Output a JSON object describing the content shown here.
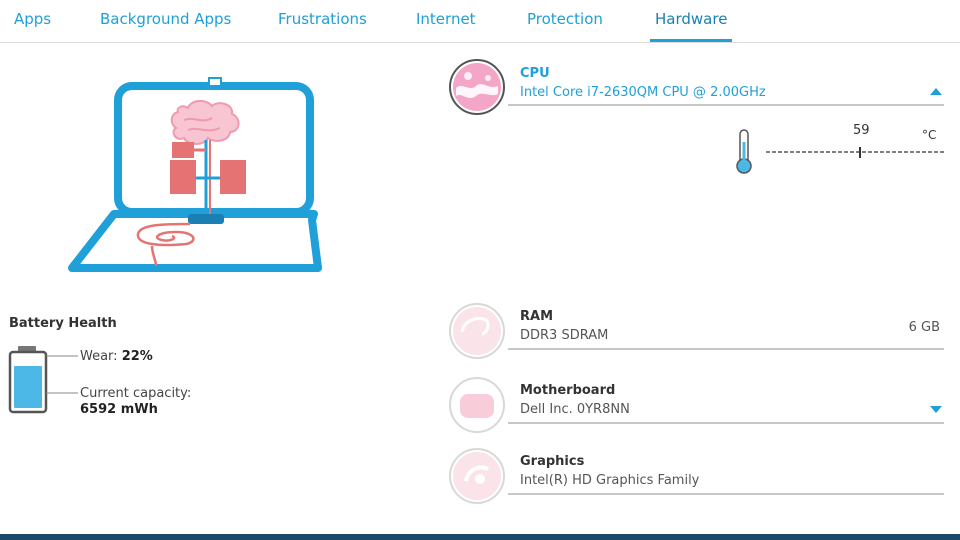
{
  "tabs": [
    {
      "label": "Apps",
      "active": false
    },
    {
      "label": "Background Apps",
      "active": false
    },
    {
      "label": "Frustrations",
      "active": false
    },
    {
      "label": "Internet",
      "active": false
    },
    {
      "label": "Protection",
      "active": false
    },
    {
      "label": "Hardware",
      "active": true
    }
  ],
  "battery": {
    "title": "Battery Health",
    "wear_label": "Wear:",
    "wear_value": "22%",
    "capacity_label": "Current capacity:",
    "capacity_value": "6592 mWh",
    "icon": "battery-icon"
  },
  "illustration": {
    "icon": "laptop-brain-icon"
  },
  "hardware": {
    "cpu": {
      "name": "CPU",
      "desc": "Intel Core i7-2630QM CPU @ 2.00GHz",
      "icon": "cpu-icon"
    },
    "temperature": {
      "value": "59",
      "unit": "°C",
      "icon": "thermometer-icon"
    },
    "ram": {
      "name": "RAM",
      "desc": "DDR3 SDRAM",
      "size": "6 GB",
      "icon": "ram-icon"
    },
    "motherboard": {
      "name": "Motherboard",
      "desc": "Dell Inc. 0YR8NN",
      "icon": "motherboard-icon"
    },
    "graphics": {
      "name": "Graphics",
      "desc": "Intel(R) HD Graphics Family",
      "icon": "graphics-icon"
    }
  },
  "colors": {
    "accent": "#1fa0d8",
    "pink": "#e57373",
    "light_pink": "#f7c6d2",
    "nav_bar": "#1c4a68"
  }
}
